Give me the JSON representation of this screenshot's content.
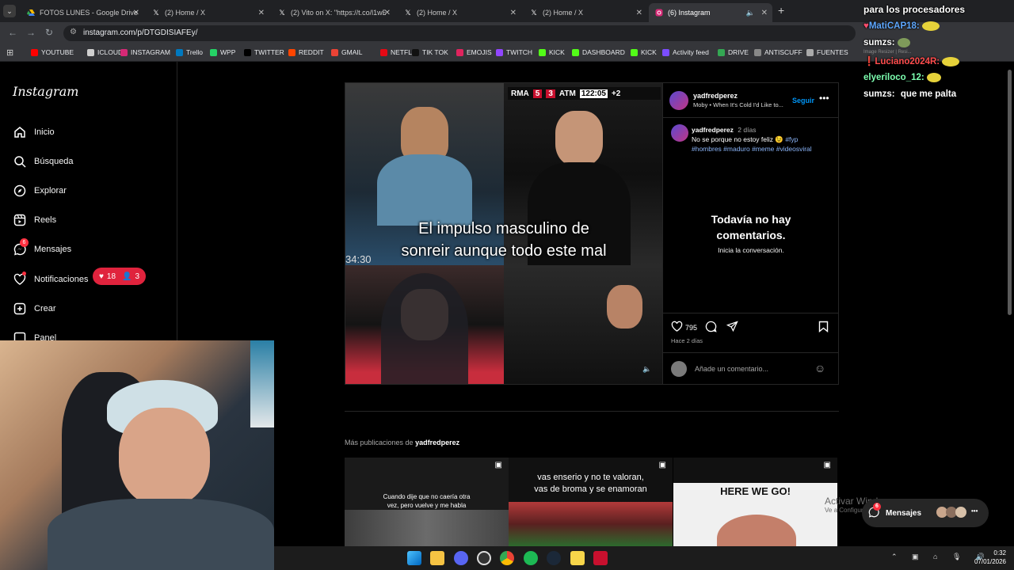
{
  "tabs": [
    {
      "title": "FOTOS LUNES - Google Drive",
      "icon": "google-drive-icon"
    },
    {
      "title": "(2) Home / X",
      "icon": "x-logo-icon"
    },
    {
      "title": "(2) Vito on X: \"https://t.co/l1wE",
      "icon": "x-logo-icon"
    },
    {
      "title": "(2) Home / X",
      "icon": "x-logo-icon"
    },
    {
      "title": "(2) Home / X",
      "icon": "x-logo-icon"
    },
    {
      "title": "(6) Instagram",
      "icon": "instagram-icon",
      "active": true
    }
  ],
  "address": {
    "url": "instagram.com/p/DTGDISIAFEy/"
  },
  "bookmarks": [
    {
      "label": "YOUTUBE",
      "color": "#ff0000"
    },
    {
      "label": "ICLOUD",
      "color": "#cfcfcf"
    },
    {
      "label": "INSTAGRAM",
      "color": "#d62976"
    },
    {
      "label": "Trello",
      "color": "#0079bf"
    },
    {
      "label": "WPP",
      "color": "#25d366"
    },
    {
      "label": "TWITTER",
      "color": "#000000"
    },
    {
      "label": "REDDIT",
      "color": "#ff4500"
    },
    {
      "label": "GMAIL",
      "color": "#ea4335"
    },
    {
      "label": "NETFLIX",
      "color": "#e50914"
    },
    {
      "label": "TIK TOK",
      "color": "#111111"
    },
    {
      "label": "EMOJIS",
      "color": "#e0245e"
    },
    {
      "label": "TWITCH",
      "color": "#9146ff"
    },
    {
      "label": "KICK",
      "color": "#53fc18"
    },
    {
      "label": "DASHBOARD",
      "color": "#53fc18"
    },
    {
      "label": "KICK",
      "color": "#53fc18"
    },
    {
      "label": "Activity feed",
      "color": "#7b4dff"
    },
    {
      "label": "DRIVE",
      "color": "#34a853"
    },
    {
      "label": "ANTISCUFF",
      "color": "#888888"
    },
    {
      "label": "FUENTES",
      "color": "#aaaaaa"
    }
  ],
  "instagram": {
    "logo": "Instagram",
    "nav": [
      {
        "label": "Inicio",
        "icon": "home-icon"
      },
      {
        "label": "Búsqueda",
        "icon": "search-icon"
      },
      {
        "label": "Explorar",
        "icon": "compass-icon"
      },
      {
        "label": "Reels",
        "icon": "reels-icon"
      },
      {
        "label": "Mensajes",
        "icon": "messenger-icon",
        "badge": "6"
      },
      {
        "label": "Notificaciones",
        "icon": "heart-icon"
      },
      {
        "label": "Crear",
        "icon": "plus-square-icon"
      },
      {
        "label": "Panel",
        "icon": "dashboard-icon"
      }
    ],
    "notifications_pill": {
      "likes": "18",
      "follows": "3"
    },
    "post": {
      "scoreboard": {
        "home": "RMA",
        "home_score": "5",
        "away_score": "3",
        "away": "ATM",
        "clock": "122:05",
        "added": "+2"
      },
      "overlay_text_1": "El impulso masculino de",
      "overlay_text_2": "sonreir aunque todo este mal",
      "panel_clock": "34:30",
      "username": "yadfredperez",
      "audio": "Moby • When It's Cold I'd Like to...",
      "follow_label": "Seguir",
      "caption_user": "yadfredperez",
      "caption_time": "2 días",
      "caption_text": "No se porque no estoy feliz 😉",
      "caption_tags_1": "#fyp",
      "caption_tags_2": "#hombres #maduro #meme #videosviral",
      "no_comments_title_1": "Todavía no hay",
      "no_comments_title_2": "comentarios.",
      "no_comments_sub": "Inicia la conversación.",
      "likes": "795",
      "posted": "Hace 2 días",
      "comment_placeholder": "Añade un comentario..."
    },
    "more_posts": {
      "prefix": "Más publicaciones de",
      "user": "yadfredperez",
      "thumbs": [
        {
          "text_1": "Cuando dije que no caería otra",
          "text_2": "vez, pero vuelve y me habla"
        },
        {
          "text_1": "vas enserio y no te valoran,",
          "text_2": "vas de broma y se enamoran"
        },
        {
          "text_1": "HERE WE GO!"
        }
      ]
    },
    "messages_bar": {
      "label": "Mensajes",
      "badge": "6"
    },
    "watermark_1": "Activar Windows",
    "watermark_2": "Ve a Configuración para activar"
  },
  "chat": {
    "header": "para los procesadores",
    "lines": [
      {
        "user": "MatiCAP18:",
        "msg": "",
        "color": "#5fa8ff"
      },
      {
        "user": "sumzs:",
        "msg": "",
        "color": "#ffffff"
      },
      {
        "user": "Luciano2024R:",
        "msg": "",
        "color": "#ff4d4d"
      },
      {
        "user": "elyeriloco_12:",
        "msg": "",
        "color": "#7dffb0"
      },
      {
        "user": "sumzs:",
        "msg": "que me palta",
        "color": "#ffffff"
      }
    ],
    "image_resizer": "Image Resizer | Resi..."
  },
  "taskbar": {
    "time": "0:32",
    "date": "07/01/2026"
  }
}
